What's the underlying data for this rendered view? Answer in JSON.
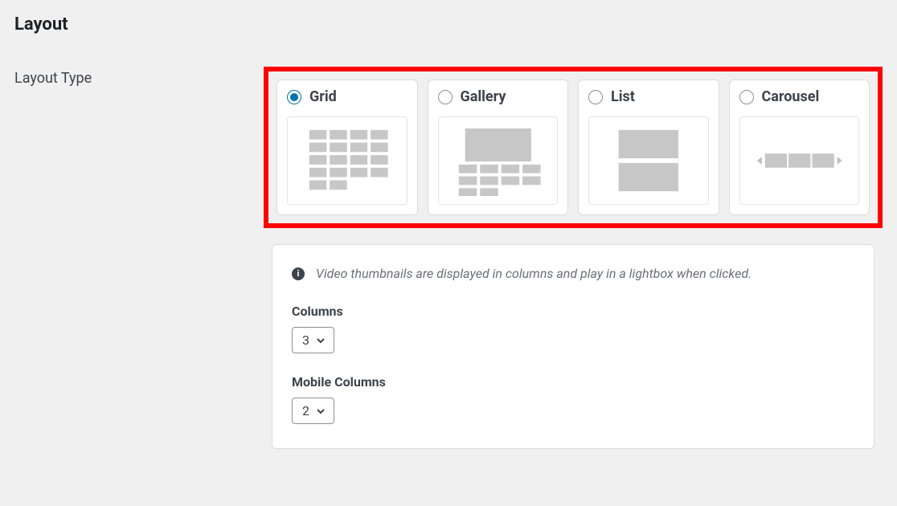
{
  "section": {
    "title": "Layout"
  },
  "layoutType": {
    "label": "Layout Type",
    "selected": "grid",
    "options": [
      {
        "id": "grid",
        "label": "Grid"
      },
      {
        "id": "gallery",
        "label": "Gallery"
      },
      {
        "id": "list",
        "label": "List"
      },
      {
        "id": "carousel",
        "label": "Carousel"
      }
    ]
  },
  "info": {
    "text": "Video thumbnails are displayed in columns and play in a lightbox when clicked."
  },
  "columns": {
    "label": "Columns",
    "value": "3"
  },
  "mobileColumns": {
    "label": "Mobile Columns",
    "value": "2"
  }
}
